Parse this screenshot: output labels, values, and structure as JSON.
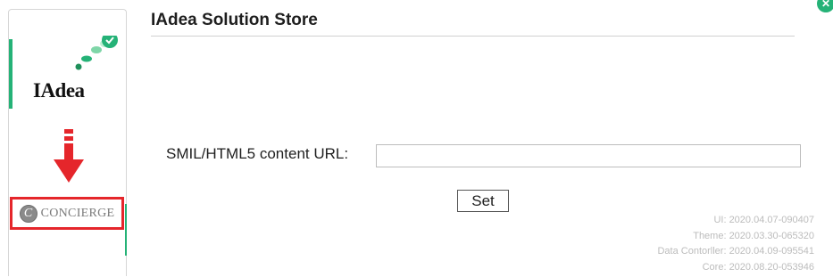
{
  "window": {
    "close_glyph": "✕"
  },
  "sidebar": {
    "iadea_logo_text": "IAdea",
    "concierge_text": "CONCIERGE",
    "concierge_mark": "C",
    "colors": {
      "accent": "#25b277",
      "arrow": "#e5262b",
      "selected_border": "#e5262b"
    }
  },
  "header": {
    "title": "IAdea Solution Store"
  },
  "form": {
    "url_label": "SMIL/HTML5 content URL:",
    "url_value": "",
    "set_label": "Set"
  },
  "versions": {
    "ui": "UI: 2020.04.07-090407",
    "theme": "Theme: 2020.03.30-065320",
    "data_controller": "Data Contorller: 2020.04.09-095541",
    "core": "Core: 2020.08.20-053946"
  }
}
